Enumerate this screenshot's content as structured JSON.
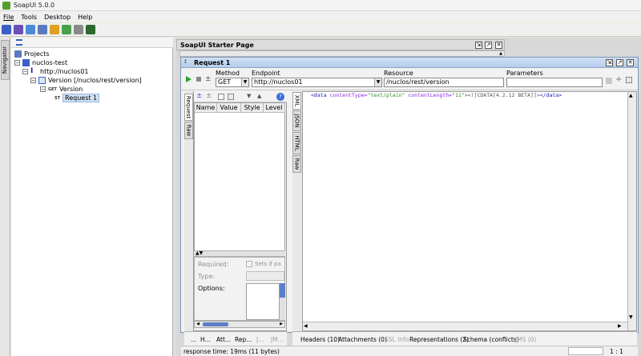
{
  "app": {
    "title": "SoapUI 5.0.0"
  },
  "menu": [
    "File",
    "Tools",
    "Desktop",
    "Help"
  ],
  "navigator": {
    "tab_label": "Navigator",
    "tree": [
      {
        "label": "Projects",
        "level": 0
      },
      {
        "label": "nuclos-test",
        "level": 1
      },
      {
        "label": "http://nuclos01",
        "level": 2
      },
      {
        "label": "Version [/nuclos/rest/version]",
        "level": 3
      },
      {
        "label": "Version",
        "level": 4,
        "method_badge": "GET"
      },
      {
        "label": "Request 1",
        "level": 5,
        "method_badge": "ST",
        "selected": true
      }
    ]
  },
  "starter": {
    "title": "SoapUI Starter Page"
  },
  "request": {
    "title": "Request 1",
    "method_label": "Method",
    "method_value": "GET",
    "endpoint_label": "Endpoint",
    "endpoint_value": "http://nuclos01",
    "resource_label": "Resource",
    "resource_value": "/nuclos/rest/version",
    "parameters_label": "Parameters",
    "parameters_value": ""
  },
  "left_vtabs": [
    "Request",
    "Raw"
  ],
  "params_table": {
    "columns": [
      "Name",
      "Value",
      "Style",
      "Level"
    ]
  },
  "details": {
    "required_label": "Required:",
    "sets_if_label": "Sets if pa",
    "type_label": "Type:",
    "options_label": "Options:"
  },
  "left_bottom_tabs": [
    "...",
    "H...",
    "Att...",
    "Rep...",
    "J...",
    "JM..."
  ],
  "right_vtabs": [
    "XML",
    "JSON",
    "HTML",
    "Raw"
  ],
  "xml": {
    "tag_open": "<data",
    "attr1": "contentType=",
    "val1": "\"text/plain\"",
    "attr2": "contentLength=",
    "val2": "\"11\"",
    "content": "><![CDATA[4.2.12 BETA]]>",
    "tag_close": "</data>"
  },
  "right_bottom_tabs": [
    {
      "label": "Headers (10)",
      "enabled": true
    },
    {
      "label": "Attachments (0)",
      "enabled": true
    },
    {
      "label": "SSL Info",
      "enabled": false
    },
    {
      "label": "Representations (2)",
      "enabled": true
    },
    {
      "label": "Schema (conflicts)",
      "enabled": true
    },
    {
      "label": "JMS (0)",
      "enabled": false
    }
  ],
  "status": {
    "response_time": "response time: 19ms (11 bytes)",
    "cursor_pos": "1 : 1"
  },
  "colors": {
    "title_gradient_top": "#cfe0f5",
    "run_green": "#2aa52a",
    "xml_tag": "#1a1ab0"
  }
}
